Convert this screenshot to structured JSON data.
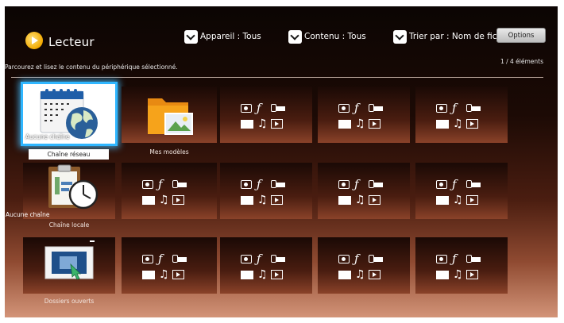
{
  "header": {
    "title": "Lecteur",
    "device_filter": "Appareil : Tous",
    "content_filter": "Contenu : Tous",
    "sort": "Trier par : Nom de fichier",
    "options_label": "Options"
  },
  "subtitle": "Parcourez et lisez le contenu du périphérique sélectionné.",
  "item_count": "1 / 4 éléments",
  "tiles": [
    {
      "label": "Chaîne réseau",
      "status": "Aucune chaîne",
      "icon": "calendar-globe-icon",
      "focused": true
    },
    {
      "label": "Mes modèles",
      "status": "",
      "icon": "folder-icon"
    },
    {
      "label": "Chaîne locale",
      "status": "Aucune chaîne",
      "icon": "clipboard-clock-icon"
    },
    {
      "label": "Dossiers ouverts",
      "status": "",
      "icon": "open-folder-screen-icon"
    }
  ],
  "colors": {
    "focus": "#2fb6ff",
    "background_top": "#0b0503",
    "background_bottom": "#d39478"
  }
}
